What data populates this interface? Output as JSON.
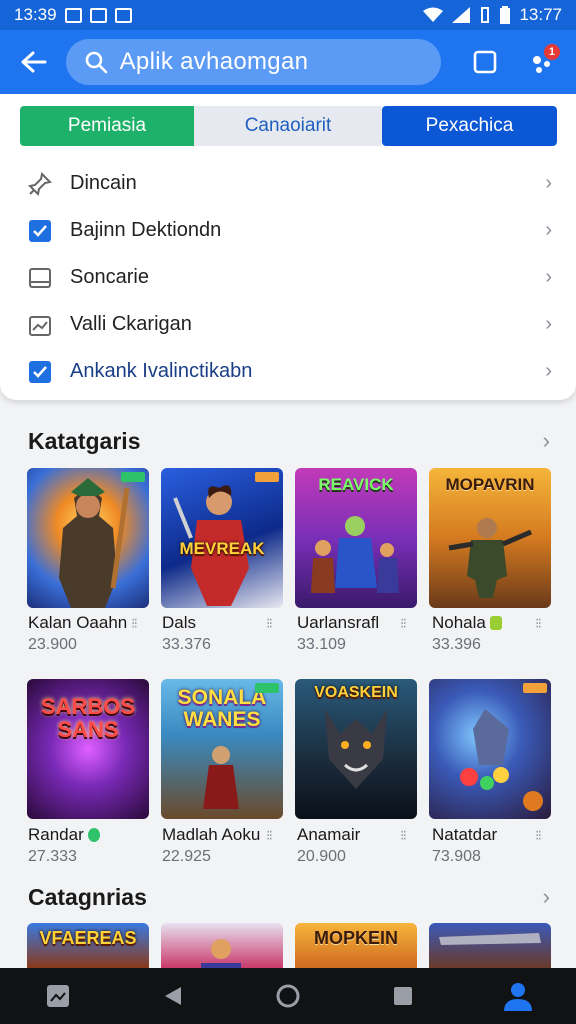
{
  "status_bar": {
    "time_left": "13:39",
    "time_right": "13:77"
  },
  "app_bar": {
    "search_text": "Aplik avhaomgan",
    "notification_count": "1"
  },
  "tabs": [
    "Pemiasia",
    "Canaoiarit",
    "Pexachica"
  ],
  "menu_items": [
    {
      "label": "Dincain",
      "icon": "pin-icon"
    },
    {
      "label": "Bajinn Dektiondn",
      "icon": "checkbox-icon",
      "checked": true
    },
    {
      "label": "Soncarie",
      "icon": "square-icon"
    },
    {
      "label": "Valli Ckarigan",
      "icon": "chart-icon"
    },
    {
      "label": "Ankank Ivalinctikabn",
      "icon": "checkbox-icon",
      "checked": true
    }
  ],
  "section1": {
    "title": "Katatgaris"
  },
  "section2": {
    "title": "Catagnrias"
  },
  "games_row1": [
    {
      "name": "Kalan Oaahn",
      "count": "23.900",
      "art": ""
    },
    {
      "name": "Dals",
      "count": "33.376",
      "art": "MEVREAK"
    },
    {
      "name": "Uarlansrafl",
      "count": "33.109",
      "art": "REAVICK"
    },
    {
      "name": "Nohala",
      "count": "33.396",
      "art": "MOPAVRIN"
    }
  ],
  "games_row2": [
    {
      "name": "Randar",
      "count": "27.333",
      "art": "SARBOS SANS"
    },
    {
      "name": "Madlah Aoku",
      "count": "22.925",
      "art": "SONALA WANES"
    },
    {
      "name": "Anamair",
      "count": "20.900",
      "art": "VOASKEIN"
    },
    {
      "name": "Natatdar",
      "count": "73.908",
      "art": ""
    }
  ],
  "games_row3": [
    {
      "art": "VFAEREAS"
    },
    {
      "art": ""
    },
    {
      "art": "MOPKEIN"
    },
    {
      "art": ""
    }
  ],
  "colors": {
    "primary": "#1f74f0",
    "green_tab": "#1db169",
    "active_tab": "#0b57d6"
  }
}
